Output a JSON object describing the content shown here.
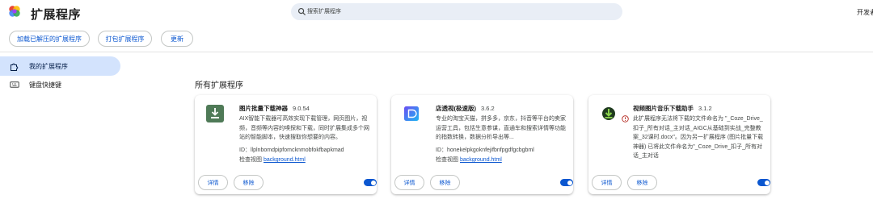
{
  "header": {
    "title": "扩展程序",
    "search_placeholder": "搜索扩展程序",
    "dev_mode_label": "开发者模式"
  },
  "toolbar": {
    "load_unpacked": "加载已解压的扩展程序",
    "pack": "打包扩展程序",
    "update": "更新"
  },
  "sidebar": {
    "items": [
      {
        "label": "我的扩展程序",
        "icon": "puzzle-icon",
        "active": true
      },
      {
        "label": "键盘快捷键",
        "icon": "keyboard-icon",
        "active": false
      }
    ]
  },
  "main": {
    "section_title": "所有扩展程序",
    "inspect_label": "检查视图",
    "details_label": "详情",
    "remove_label": "移除",
    "extensions": [
      {
        "name": "图片批量下载神器",
        "version": "9.0.54",
        "description": "AIX智能下载器可高效实现下载管理，网页图片，视频，音频等内容的嗅探和下载，同时扩展集成多个网站的智能脚本，快速搜取你想要的内容。",
        "id": "ID：llplnbomdpipfomcknmobfokfbapkmad",
        "inspect_link": "background.html",
        "enabled": true,
        "icon": "download-icon"
      },
      {
        "name": "店透视(极速版)",
        "version": "3.6.2",
        "description": "专业的淘宝天猫，拼多多，京东，抖音等平台的卖家运营工具，包括生意参谋，直通车和搜索详情等功能的指数转换，数据分析导出等...",
        "id": "ID：honekelpkgoknfejifbnfpgdfgcbgbml",
        "inspect_link": "background.html",
        "enabled": true,
        "icon": "store-icon"
      },
      {
        "name": "视频图片音乐下载助手",
        "version": "3.1.2",
        "error_text": "此扩展程序无法将下载的文件命名为 \"_Coze_Drive_扣子_所有对话_主对话_AIGC从基础到实战_完整教案_32课时.docx\"。因为另一扩展程序 (图片批量下载神器) 已将此文件命名为\"_Coze_Drive_扣子_所有对话_主对话",
        "enabled": true,
        "icon": "download-arrow-icon"
      }
    ]
  },
  "colors": {
    "accent": "#0b57d0",
    "sidebar_active": "#d3e3fd",
    "search_bg": "#e9eef6",
    "error": "#b3261e"
  }
}
